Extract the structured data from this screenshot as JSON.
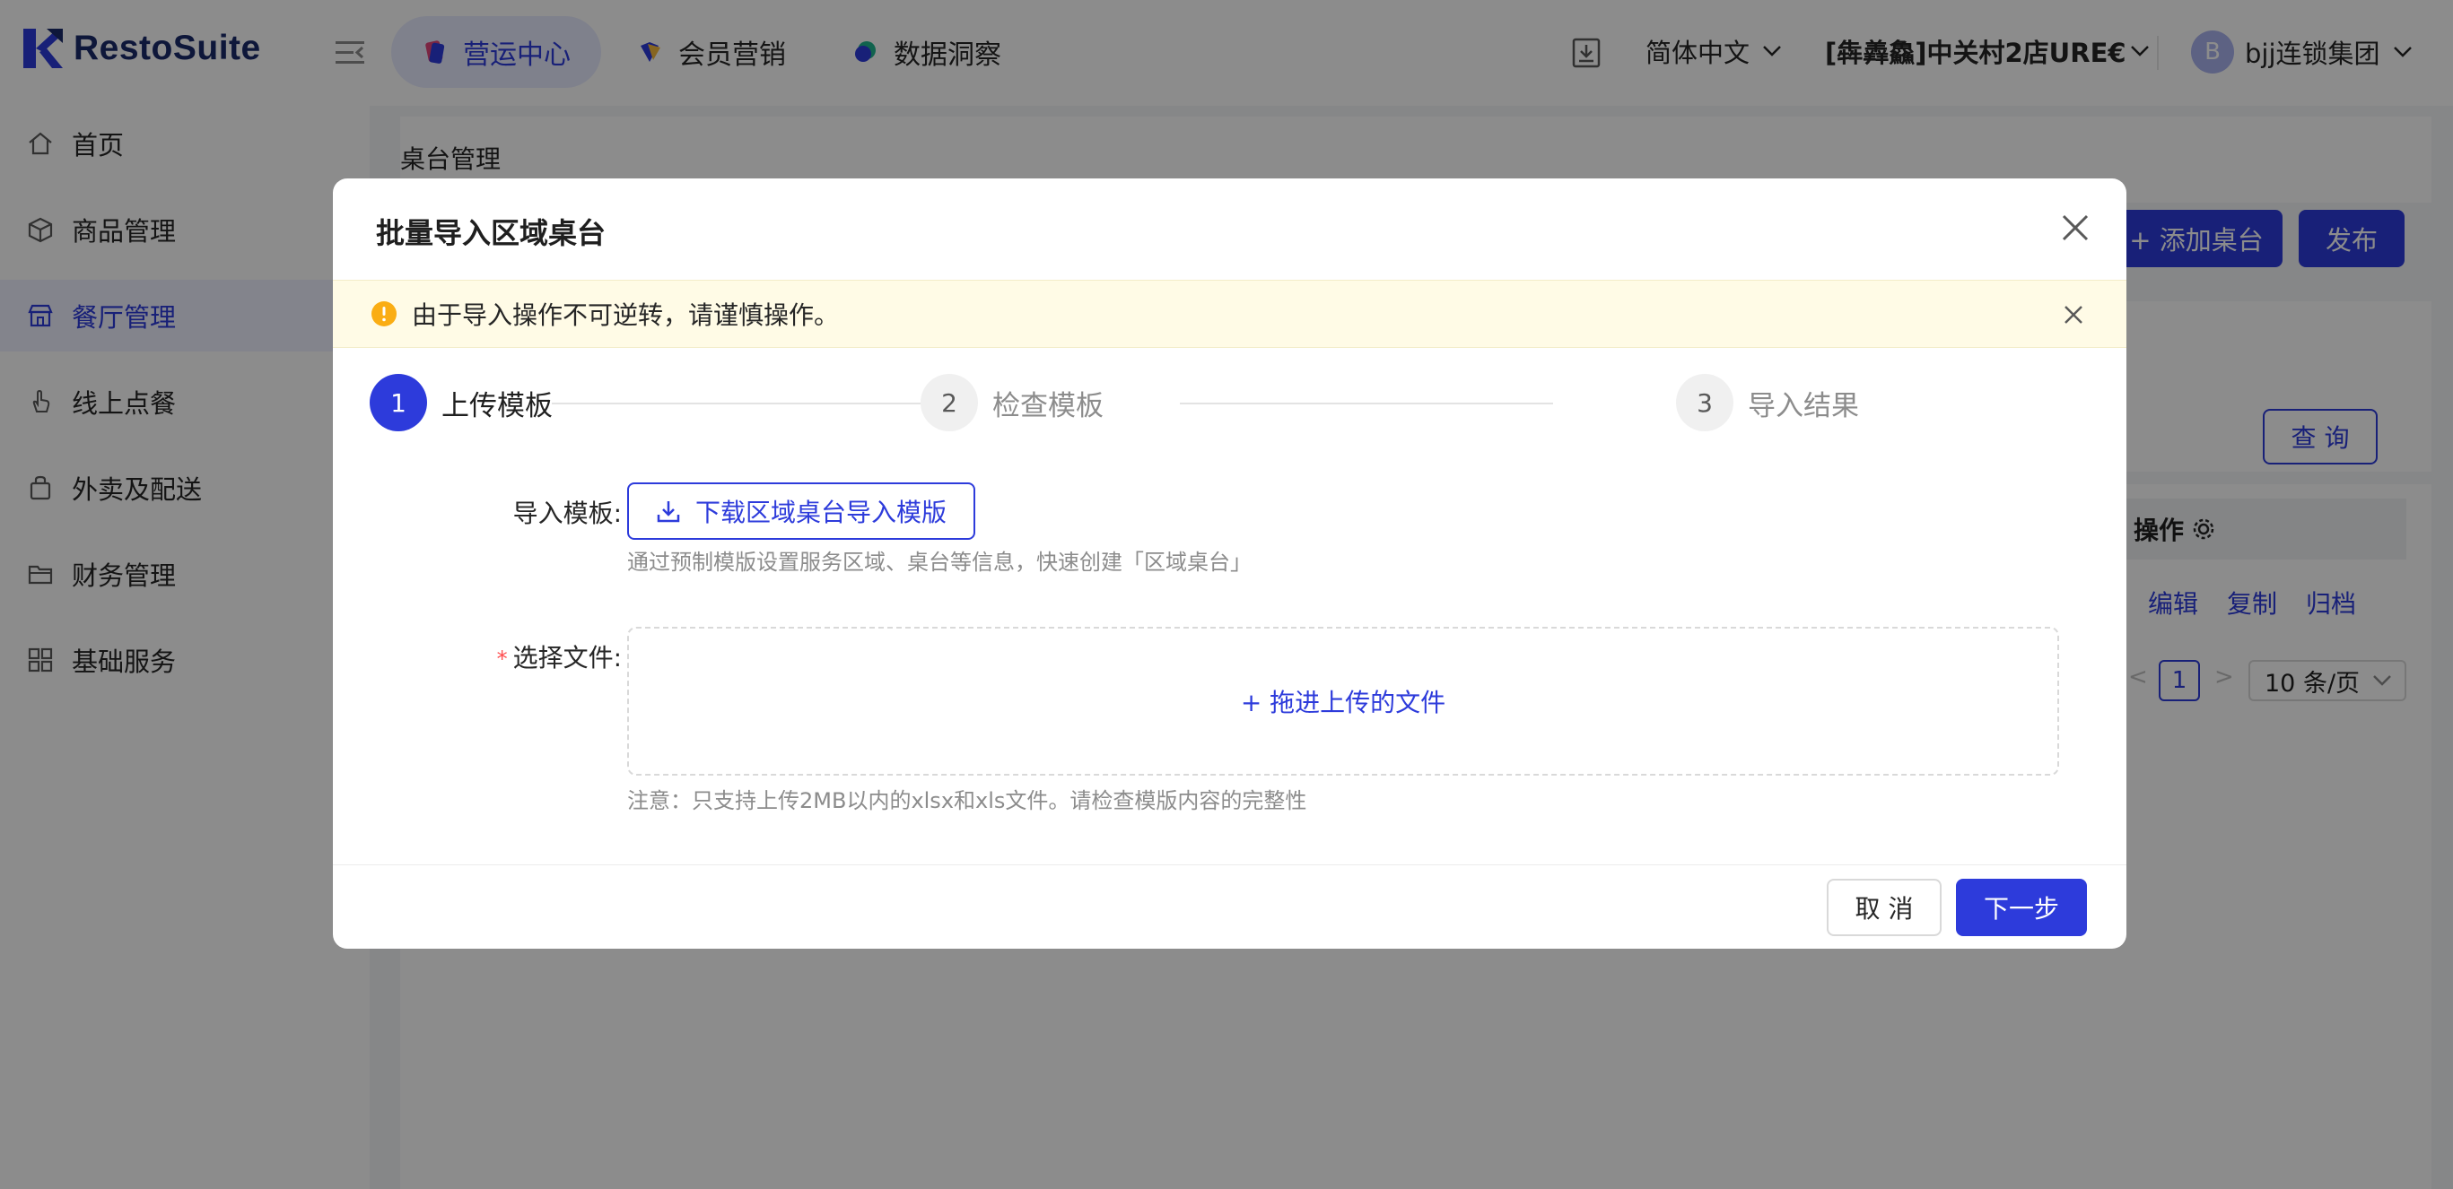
{
  "header": {
    "brand": "RestoSuite",
    "tabs": [
      {
        "label": "营运中心",
        "icon": "operations-icon",
        "active": true
      },
      {
        "label": "会员营销",
        "icon": "member-icon",
        "active": false
      },
      {
        "label": "数据洞察",
        "icon": "data-icon",
        "active": false
      }
    ],
    "language": "简体中文",
    "store": "[犇羴鱻]中关村2店URE€",
    "avatar_letter": "B",
    "user": "bjj连锁集团"
  },
  "sidebar": {
    "items": [
      {
        "label": "首页",
        "icon": "home-icon",
        "active": false
      },
      {
        "label": "商品管理",
        "icon": "cube-icon",
        "active": false
      },
      {
        "label": "餐厅管理",
        "icon": "store-icon",
        "active": true
      },
      {
        "label": "线上点餐",
        "icon": "hand-pointer-icon",
        "active": false
      },
      {
        "label": "外卖及配送",
        "icon": "bag-icon",
        "active": false
      },
      {
        "label": "财务管理",
        "icon": "folder-icon",
        "active": false
      },
      {
        "label": "基础服务",
        "icon": "grid-icon",
        "active": false
      }
    ]
  },
  "page": {
    "breadcrumb": "桌台管理",
    "add_button": "+ 添加桌台",
    "publish_button": "发布",
    "query_button": "查 询",
    "table_header_action": "操作",
    "row_actions": [
      "编辑",
      "复制",
      "归档"
    ],
    "pagination": {
      "current": "1",
      "page_size": "10 条/页"
    }
  },
  "modal": {
    "title": "批量导入区域桌台",
    "alert": "由于导入操作不可逆转，请谨慎操作。",
    "steps": [
      {
        "num": "1",
        "label": "上传模板",
        "state": "active"
      },
      {
        "num": "2",
        "label": "检查模板",
        "state": "idle"
      },
      {
        "num": "3",
        "label": "导入结果",
        "state": "idle"
      }
    ],
    "template_label": "导入模板:",
    "download_button": "下载区域桌台导入模版",
    "template_hint": "通过预制模版设置服务区域、桌台等信息，快速创建「区域桌台」",
    "file_label": "选择文件:",
    "file_required_mark": "*",
    "dropzone_text": "+ 拖进上传的文件",
    "file_hint": "注意：只支持上传2MB以内的xlsx和xls文件。请检查模版内容的完整性",
    "cancel_button": "取 消",
    "next_button": "下一步"
  },
  "colors": {
    "primary": "#2d3bdb",
    "alert_bg": "#fffbe6",
    "warning": "#faad14",
    "required": "#ff4d4f"
  }
}
